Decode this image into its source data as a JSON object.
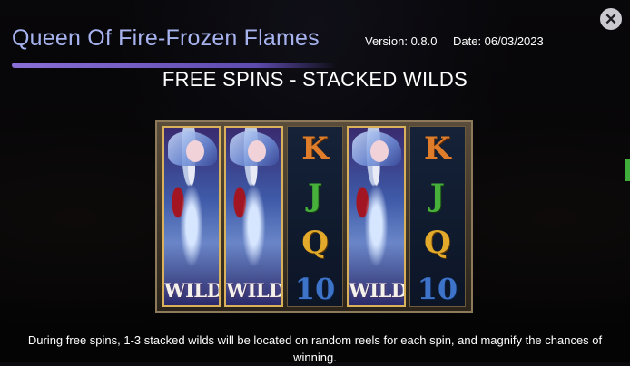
{
  "header": {
    "title": "Queen Of Fire-Frozen Flames",
    "version": "Version: 0.8.0",
    "date": "Date: 06/03/2023",
    "close_icon": "close-icon"
  },
  "section": {
    "title": "FREE SPINS - STACKED WILDS",
    "reels": [
      {
        "type": "stacked-wild",
        "label": "WILD"
      },
      {
        "type": "stacked-wild",
        "label": "WILD"
      },
      {
        "type": "symbols",
        "symbols": [
          "K",
          "J",
          "Q",
          "10"
        ]
      },
      {
        "type": "stacked-wild",
        "label": "WILD"
      },
      {
        "type": "symbols",
        "symbols": [
          "K",
          "J",
          "Q",
          "10"
        ]
      }
    ],
    "description": "During free spins, 1-3 stacked wilds will be located on random reels for each spin, and magnify the chances of winning."
  },
  "colors": {
    "title": "#a7b3ee",
    "accent": "#7a63cc",
    "k": "#e07d2a",
    "j": "#46b03b",
    "q": "#e2a92a",
    "ten": "#3d73c9"
  }
}
